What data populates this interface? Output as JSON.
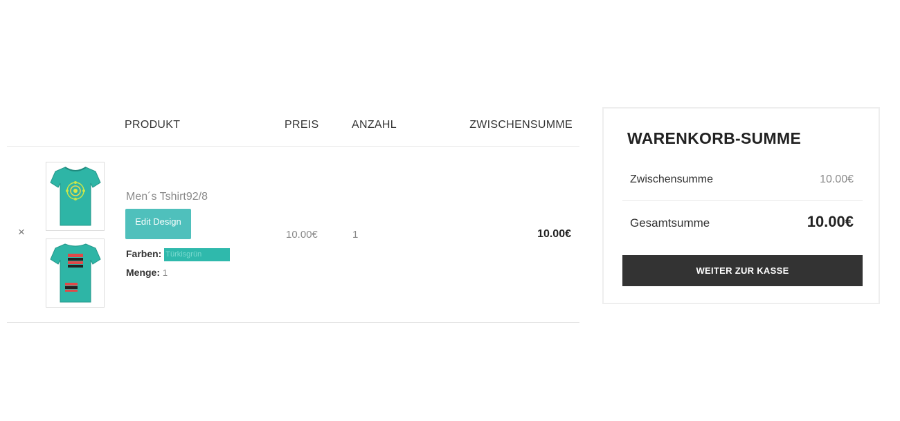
{
  "cart": {
    "headers": {
      "product": "PRODUKT",
      "price": "PREIS",
      "quantity": "ANZAHL",
      "subtotal": "ZWISCHENSUMME"
    },
    "item": {
      "remove_symbol": "×",
      "name": "Men´s Tshirt92/8",
      "edit_label": "Edit Design",
      "colors_label": "Farben:",
      "colors_value": "Türkisgrün",
      "colors_swatch": "#2fb9ac",
      "qty_label": "Menge:",
      "qty_value": "1",
      "price": "10.00€",
      "quantity": "1",
      "subtotal": "10.00€",
      "shirt_color": "#2eb5a6"
    }
  },
  "totals": {
    "title": "WARENKORB-SUMME",
    "subtotal_label": "Zwischensumme",
    "subtotal_value": "10.00€",
    "total_label": "Gesamtsumme",
    "total_value": "10.00€",
    "checkout_label": "WEITER ZUR KASSE"
  }
}
